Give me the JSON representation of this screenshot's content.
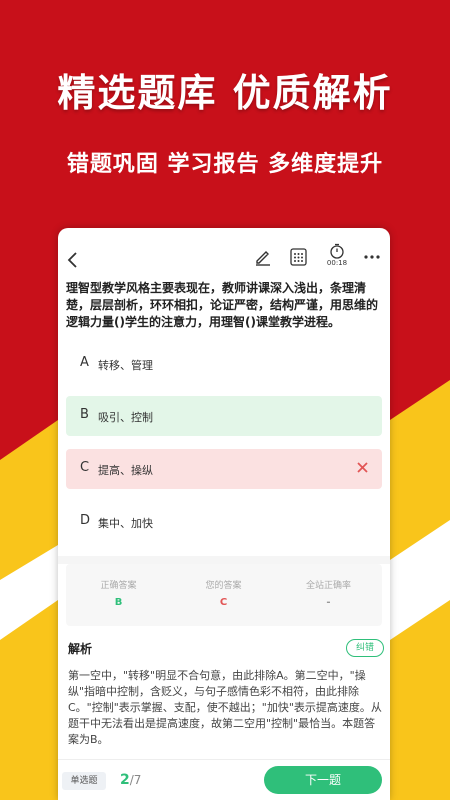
{
  "banner": {
    "headline": "精选题库  优质解析",
    "subheadline": "错题巩固 学习报告 多维度提升"
  },
  "colors": {
    "brand_red": "#c8101a",
    "accent_yellow": "#f9c51b",
    "accent_green": "#2fbf7a",
    "wrong_red": "#e25555"
  },
  "toolbar": {
    "back_icon": "chevron-left-icon",
    "pen_icon": "pen-icon",
    "calc_icon": "calculator-icon",
    "timer_icon": "timer-icon",
    "timer_text": "00:18",
    "more_icon": "more-icon"
  },
  "question": {
    "text": "理智型教学风格主要表现在，教师讲课深入浅出，条理清楚，层层剖析，环环相扣，论证严密，结构严谨，用思维的逻辑力量()学生的注意力，用理智()课堂教学进程。"
  },
  "options": [
    {
      "letter": "A",
      "text": "转移、管理"
    },
    {
      "letter": "B",
      "text": "吸引、控制"
    },
    {
      "letter": "C",
      "text": "提高、操纵"
    },
    {
      "letter": "D",
      "text": "集中、加快"
    }
  ],
  "stats": {
    "correct_label": "正确答案",
    "correct_value": "B",
    "your_label": "您的答案",
    "your_value": "C",
    "rate_label": "全站正确率",
    "rate_value": "-"
  },
  "analysis": {
    "title": "解析",
    "report_error": "纠错",
    "body": "第一空中，\"转移\"明显不合句意，由此排除A。第二空中，\"操纵\"指暗中控制，含贬义，与句子感情色彩不相符，由此排除C。\"控制\"表示掌握、支配，使不越出；\"加快\"表示提高速度。从题干中无法看出是提高速度，故第二空用\"控制\"最恰当。本题答案为B。"
  },
  "footer": {
    "type": "单选题",
    "current": "2",
    "total": "/7",
    "next": "下一题"
  }
}
